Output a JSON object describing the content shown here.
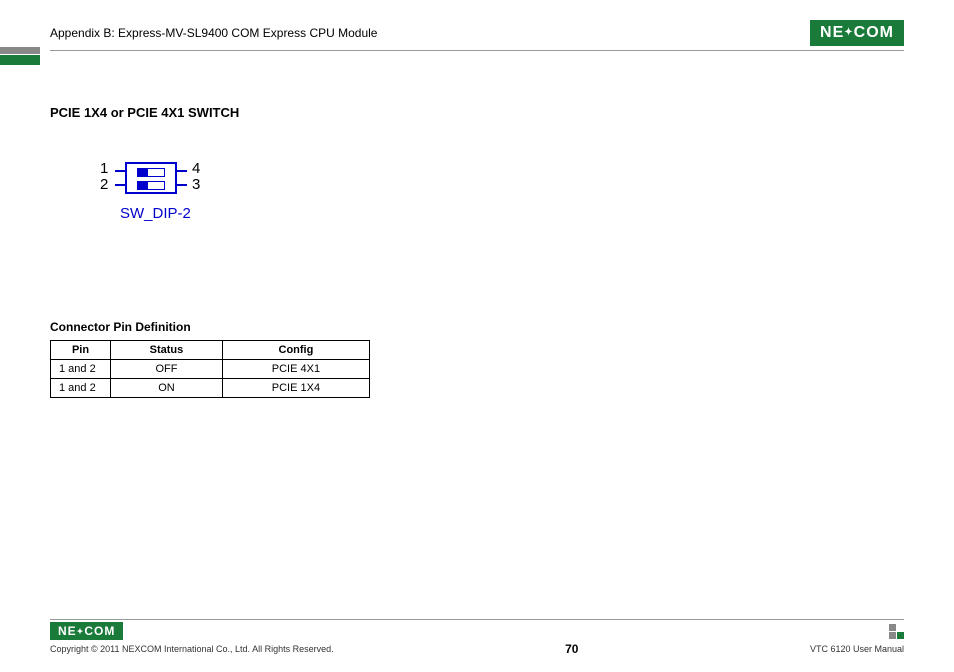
{
  "header": {
    "appendix": "Appendix B: Express-MV-SL9400 COM Express CPU Module",
    "brand": "NE COM"
  },
  "section": {
    "title": "PCIE 1X4 or PCIE 4X1 SWITCH"
  },
  "diagram": {
    "label": "SW_DIP-2",
    "pin1": "1",
    "pin2": "2",
    "pin3": "3",
    "pin4": "4"
  },
  "table": {
    "title": "Connector Pin Definition",
    "headers": {
      "pin": "Pin",
      "status": "Status",
      "config": "Config"
    },
    "rows": [
      {
        "pin": "1 and 2",
        "status": "OFF",
        "config": "PCIE 4X1"
      },
      {
        "pin": "1 and 2",
        "status": "ON",
        "config": "PCIE 1X4"
      }
    ]
  },
  "footer": {
    "brand": "NE COM",
    "copyright": "Copyright © 2011 NEXCOM International Co., Ltd. All Rights Reserved.",
    "page_number": "70",
    "doc": "VTC 6120 User Manual"
  }
}
